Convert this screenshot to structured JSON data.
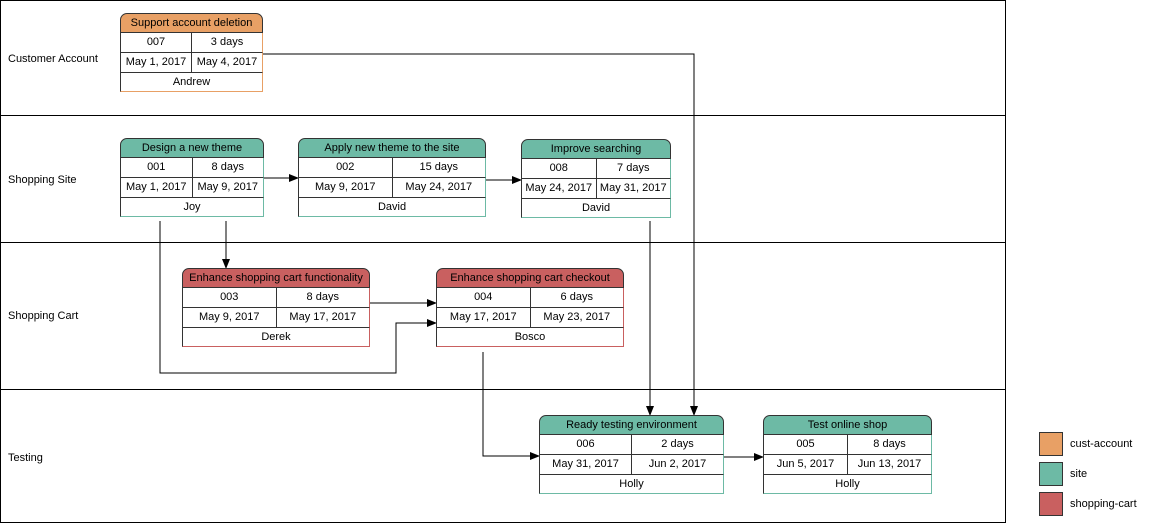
{
  "lanes": [
    {
      "label": "Customer Account"
    },
    {
      "label": "Shopping Site"
    },
    {
      "label": "Shopping Cart"
    },
    {
      "label": "Testing"
    }
  ],
  "categories": {
    "cust-account": "#e8a065",
    "site": "#6dbaa5",
    "shopping-cart": "#c96060"
  },
  "tasks": [
    {
      "title": "Support account deletion",
      "id": "007",
      "duration": "3 days",
      "start": "May 1, 2017",
      "end": "May 4, 2017",
      "owner": "Andrew",
      "category": "cust-account"
    },
    {
      "title": "Design a new theme",
      "id": "001",
      "duration": "8 days",
      "start": "May 1, 2017",
      "end": "May 9, 2017",
      "owner": "Joy",
      "category": "site"
    },
    {
      "title": "Apply new theme to the site",
      "id": "002",
      "duration": "15 days",
      "start": "May 9, 2017",
      "end": "May 24, 2017",
      "owner": "David",
      "category": "site"
    },
    {
      "title": "Improve searching",
      "id": "008",
      "duration": "7 days",
      "start": "May 24, 2017",
      "end": "May 31, 2017",
      "owner": "David",
      "category": "site"
    },
    {
      "title": "Enhance shopping cart functionality",
      "id": "003",
      "duration": "8 days",
      "start": "May 9, 2017",
      "end": "May 17, 2017",
      "owner": "Derek",
      "category": "shopping-cart"
    },
    {
      "title": "Enhance shopping cart checkout",
      "id": "004",
      "duration": "6 days",
      "start": "May 17, 2017",
      "end": "May 23, 2017",
      "owner": "Bosco",
      "category": "shopping-cart"
    },
    {
      "title": "Ready testing environment",
      "id": "006",
      "duration": "2 days",
      "start": "May 31, 2017",
      "end": "Jun 2, 2017",
      "owner": "Holly",
      "category": "site"
    },
    {
      "title": "Test online shop",
      "id": "005",
      "duration": "8 days",
      "start": "Jun 5, 2017",
      "end": "Jun 13, 2017",
      "owner": "Holly",
      "category": "site"
    }
  ],
  "dependencies": [
    {
      "from": "001",
      "to": "002"
    },
    {
      "from": "002",
      "to": "008"
    },
    {
      "from": "001",
      "to": "003"
    },
    {
      "from": "001",
      "to": "004"
    },
    {
      "from": "003",
      "to": "004"
    },
    {
      "from": "004",
      "to": "006"
    },
    {
      "from": "008",
      "to": "006"
    },
    {
      "from": "007",
      "to": "006"
    },
    {
      "from": "006",
      "to": "005"
    }
  ],
  "legend": [
    {
      "label": "cust-account",
      "category": "cust-account"
    },
    {
      "label": "site",
      "category": "site"
    },
    {
      "label": "shopping-cart",
      "category": "shopping-cart"
    }
  ]
}
